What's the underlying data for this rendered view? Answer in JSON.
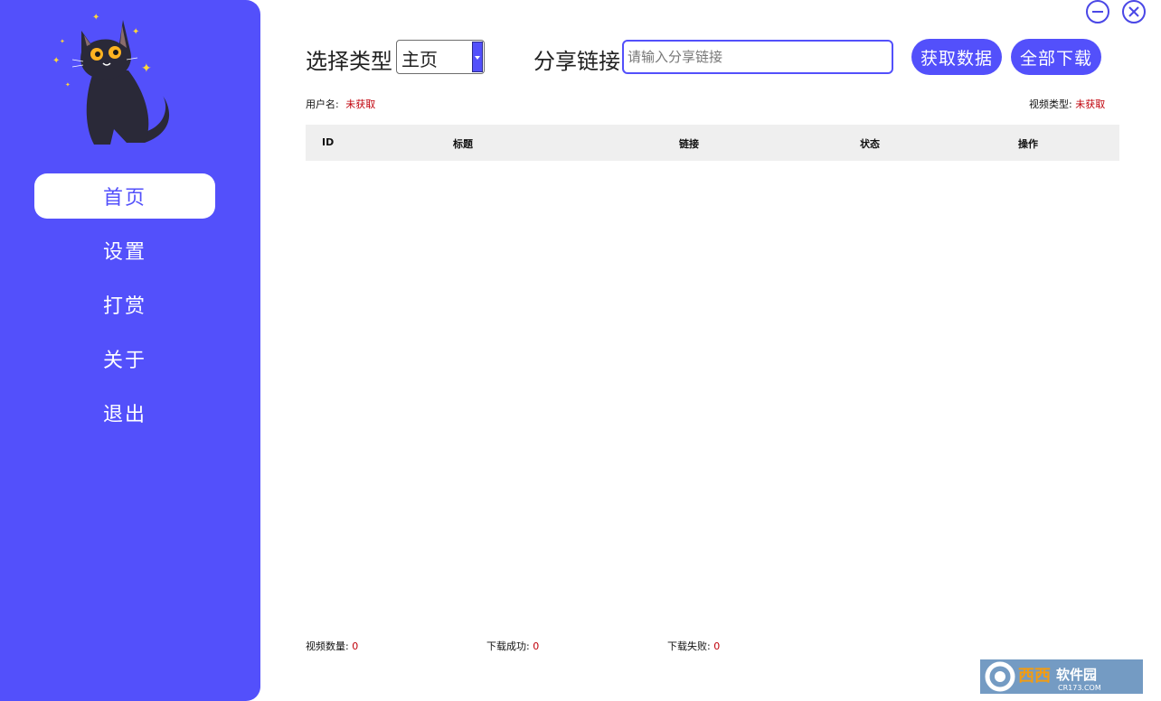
{
  "sidebar": {
    "items": [
      {
        "label": "首页",
        "active": true
      },
      {
        "label": "设置",
        "active": false
      },
      {
        "label": "打赏",
        "active": false
      },
      {
        "label": "关于",
        "active": false
      },
      {
        "label": "退出",
        "active": false
      }
    ]
  },
  "window_controls": {
    "minimize_icon": "minus-circle-icon",
    "close_icon": "x-circle-icon"
  },
  "toolbar": {
    "type_label": "选择类型",
    "type_selected": "主页",
    "link_label": "分享链接",
    "link_placeholder": "请输入分享链接",
    "fetch_button": "获取数据",
    "download_all_button": "全部下载"
  },
  "info": {
    "username_label": "用户名:",
    "username_value": "未获取",
    "video_type_label": "视频类型:",
    "video_type_value": "未获取"
  },
  "table": {
    "columns": [
      "ID",
      "标题",
      "链接",
      "状态",
      "操作"
    ],
    "rows": []
  },
  "footer": {
    "video_count_label": "视频数量:",
    "video_count_value": "0",
    "download_success_label": "下载成功:",
    "download_success_value": "0",
    "download_fail_label": "下载失败:",
    "download_fail_value": "0"
  },
  "watermark": {
    "text": "西西软件园",
    "subtext": "CR173.COM"
  },
  "colors": {
    "accent": "#5350fb",
    "status_red": "#c0000a",
    "table_header_bg": "#efefef"
  }
}
